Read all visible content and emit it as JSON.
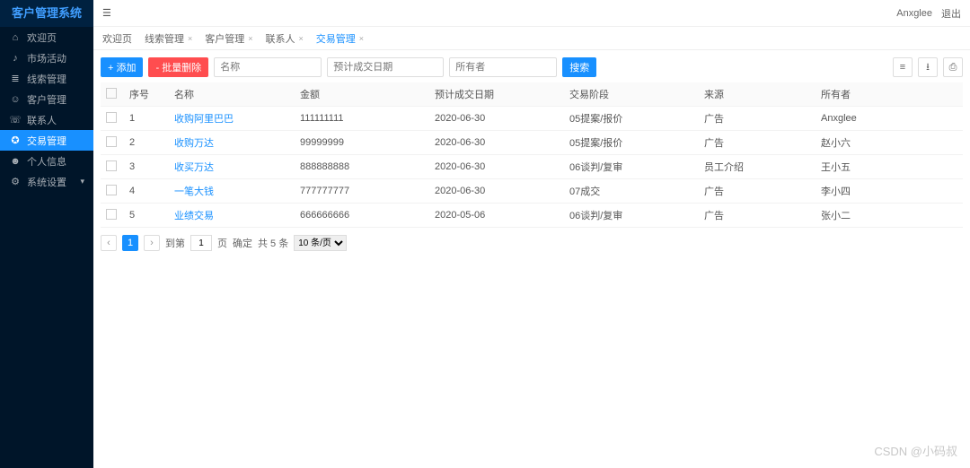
{
  "brand": "客户管理系统",
  "topbar": {
    "user": "Anxglee",
    "logout": "退出"
  },
  "watermark": "CSDN @小码叔",
  "sidebar": {
    "items": [
      {
        "icon": "home",
        "label": "欢迎页",
        "arrow": false,
        "active": false
      },
      {
        "icon": "bell",
        "label": "市场活动",
        "arrow": false,
        "active": false
      },
      {
        "icon": "list",
        "label": "线索管理",
        "arrow": false,
        "active": false
      },
      {
        "icon": "user",
        "label": "客户管理",
        "arrow": false,
        "active": false
      },
      {
        "icon": "contacts",
        "label": "联系人",
        "arrow": false,
        "active": false
      },
      {
        "icon": "deal",
        "label": "交易管理",
        "arrow": false,
        "active": true
      },
      {
        "icon": "profile",
        "label": "个人信息",
        "arrow": false,
        "active": false
      },
      {
        "icon": "settings",
        "label": "系统设置",
        "arrow": true,
        "active": false
      }
    ]
  },
  "tabs": [
    {
      "label": "欢迎页",
      "closable": false,
      "active": false
    },
    {
      "label": "线索管理",
      "closable": true,
      "active": false
    },
    {
      "label": "客户管理",
      "closable": true,
      "active": false
    },
    {
      "label": "联系人",
      "closable": true,
      "active": false
    },
    {
      "label": "交易管理",
      "closable": true,
      "active": true
    }
  ],
  "toolbar": {
    "add_label": "+ 添加",
    "delete_label": "- 批量删除",
    "search_label": "搜索",
    "filter_name_ph": "名称",
    "filter_date_ph": "预计成交日期",
    "filter_owner_ph": "所有者"
  },
  "table": {
    "headers": {
      "idx": "序号",
      "name": "名称",
      "amount": "金额",
      "date": "预计成交日期",
      "stage": "交易阶段",
      "source": "来源",
      "owner": "所有者"
    },
    "rows": [
      {
        "idx": "1",
        "name": "收购阿里巴巴",
        "amount": "111111111",
        "date": "2020-06-30",
        "stage": "05提案/报价",
        "source": "广告",
        "owner": "Anxglee"
      },
      {
        "idx": "2",
        "name": "收购万达",
        "amount": "99999999",
        "date": "2020-06-30",
        "stage": "05提案/报价",
        "source": "广告",
        "owner": "赵小六"
      },
      {
        "idx": "3",
        "name": "收买万达",
        "amount": "888888888",
        "date": "2020-06-30",
        "stage": "06谈判/复审",
        "source": "员工介绍",
        "owner": "王小五"
      },
      {
        "idx": "4",
        "name": "一笔大钱",
        "amount": "777777777",
        "date": "2020-06-30",
        "stage": "07成交",
        "source": "广告",
        "owner": "李小四"
      },
      {
        "idx": "5",
        "name": "业绩交易",
        "amount": "666666666",
        "date": "2020-05-06",
        "stage": "06谈判/复审",
        "source": "广告",
        "owner": "张小二"
      }
    ]
  },
  "pagination": {
    "current": "1",
    "goto_label": "到第",
    "page_unit": "页",
    "confirm": "确定",
    "total": "共 5 条",
    "per_page": "10 条/页"
  }
}
